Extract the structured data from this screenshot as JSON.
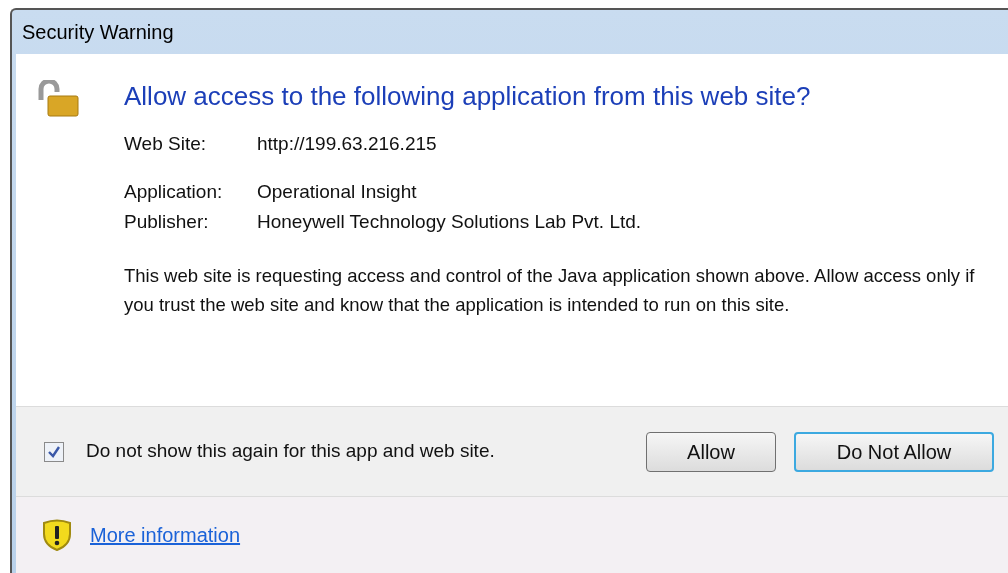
{
  "window": {
    "title": "Security Warning"
  },
  "heading": "Allow access to the following application from this web site?",
  "details": [
    {
      "label": "Web Site:",
      "value": "http://199.63.216.215"
    },
    {
      "label": "Application:",
      "value": "Operational Insight"
    },
    {
      "label": "Publisher:",
      "value": "Honeywell Technology Solutions Lab Pvt. Ltd."
    }
  ],
  "message": "This web site is requesting access and control of the Java application shown above. Allow access only if you trust the web site and know that the application is intended to run on this site.",
  "dont_show_again": {
    "label": "Do not show this again for this app and web site.",
    "checked": true
  },
  "buttons": [
    {
      "label": "Allow",
      "focused": false
    },
    {
      "label": "Do Not Allow",
      "focused": true
    }
  ],
  "more_info_link": "More information"
}
